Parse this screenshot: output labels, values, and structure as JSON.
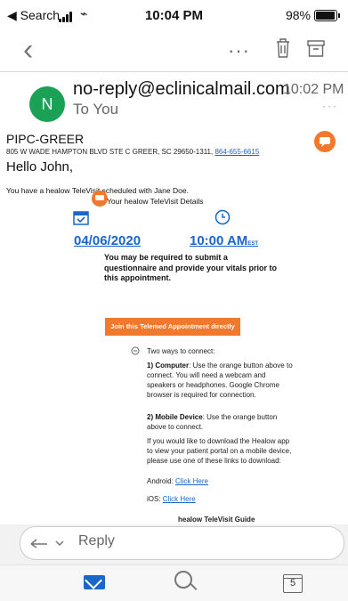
{
  "status_bar": {
    "back_label": "◀ Search",
    "time": "10:04 PM",
    "battery": "98%"
  },
  "message": {
    "avatar_letter": "N",
    "sender": "no-reply@eclinicalmail.com",
    "to": "To You",
    "time": "10:02 PM",
    "more_dots": "···"
  },
  "body": {
    "practice": "PIPC-GREER",
    "address": "805 W WADE HAMPTON BLVD STE C GREER, SC 29650-1311, ",
    "phone": "864-655-6615",
    "greeting": "Hello John,",
    "scheduled": "You have a healow TeleVisit scheduled with Jane Doe.",
    "details_label": "Your healow TeleVisit Details",
    "date": "04/06/2020",
    "time": "10:00 AM",
    "tz": "EST",
    "notice": "You may be required to submit a questionnaire and provide your vitals prior to this appointment.",
    "join_button": "Join this Telemed Appointment directly",
    "two_ways": "Two ways to connect:",
    "computer_title": "1) Computer",
    "computer_text": ": Use the orange button above to connect. You will need a webcam and speakers or headphones. Google Chrome browser is required for connection.",
    "mobile_title": "2) Mobile Device",
    "mobile_text": ": Use the orange button above to connect.",
    "download_text": "If you would like to download the Healow app to view your patient portal on a mobile device, please use one of these links to download:",
    "android_label": "Android: ",
    "ios_label": "iOS: ",
    "click_here": "Click Here",
    "guide_cut": "healow TeleVisit Guide"
  },
  "reply_bar": {
    "label": "Reply"
  },
  "tabbar": {
    "calendar_day": "5"
  }
}
